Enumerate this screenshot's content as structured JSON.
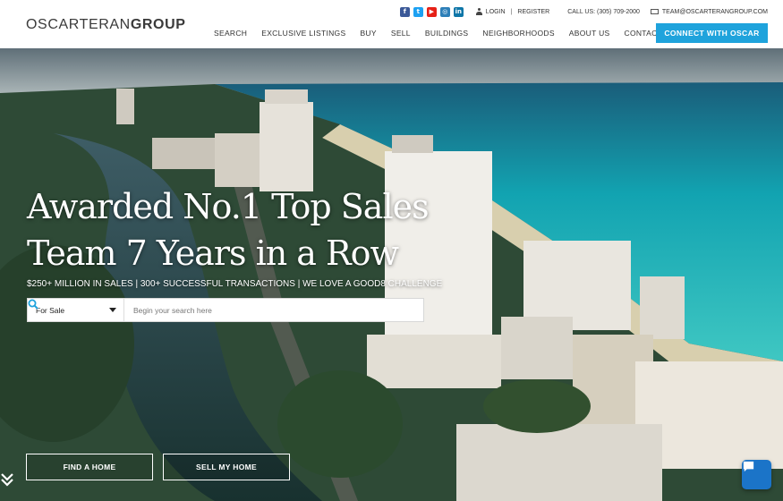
{
  "brand": {
    "logo_light": "OSCARTERAN",
    "logo_bold": "GROUP"
  },
  "topbar": {
    "socials": [
      {
        "icon": "facebook-icon",
        "glyph": "f"
      },
      {
        "icon": "twitter-icon",
        "glyph": "t"
      },
      {
        "icon": "youtube-icon",
        "glyph": "▶"
      },
      {
        "icon": "instagram-icon",
        "glyph": "◎"
      },
      {
        "icon": "linkedin-icon",
        "glyph": "in"
      }
    ],
    "login": "LOGIN",
    "separator": "|",
    "register": "REGISTER",
    "call": "CALL US: (305) 709-2000",
    "email": "TEAM@OSCARTERANGROUP.COM"
  },
  "nav": {
    "items": [
      "SEARCH",
      "EXCLUSIVE LISTINGS",
      "BUY",
      "SELL",
      "BUILDINGS",
      "NEIGHBORHOODS",
      "ABOUT US",
      "CONTACT US"
    ],
    "cta": "CONNECT WITH OSCAR"
  },
  "hero": {
    "headline_1": "Awarded No.1 Top Sales",
    "headline_2": "Team 7 Years in a Row",
    "tagline": "$250+ MILLION IN SALES | 300+ SUCCESSFUL TRANSACTIONS | WE LOVE A GOOD8 CHALLENGE",
    "search": {
      "selected": "For Sale",
      "placeholder": "Begin your search here"
    },
    "buttons": {
      "find": "FIND A HOME",
      "sell": "SELL MY HOME"
    }
  },
  "colors": {
    "accent": "#1fa3dc",
    "chat": "#1b74c8",
    "facebook": "#3b5998",
    "twitter": "#1da1f2",
    "youtube": "#e62117",
    "linkedin": "#0e76a8"
  }
}
